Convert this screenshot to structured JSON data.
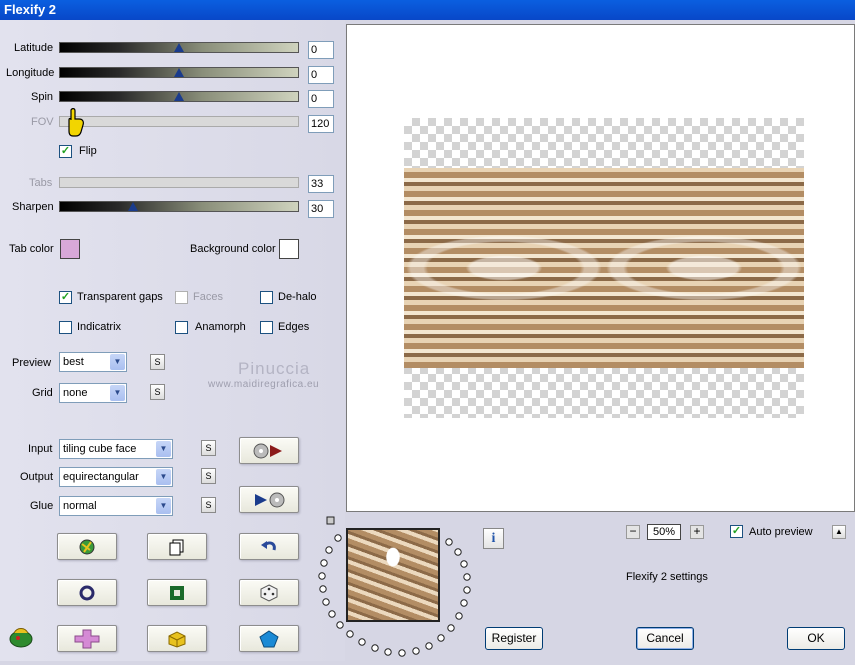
{
  "window": {
    "title": "Flexify 2"
  },
  "sliders": {
    "latitude": {
      "label": "Latitude",
      "value": "0"
    },
    "longitude": {
      "label": "Longitude",
      "value": "0"
    },
    "spin": {
      "label": "Spin",
      "value": "0"
    },
    "fov": {
      "label": "FOV",
      "value": "120"
    },
    "tabs": {
      "label": "Tabs",
      "value": "33"
    },
    "sharpen": {
      "label": "Sharpen",
      "value": "30"
    }
  },
  "flip": {
    "label": "Flip",
    "checked": true
  },
  "colors": {
    "tab_color_label": "Tab color",
    "tab_color": "#d8a8d8",
    "background_color_label": "Background color",
    "background_color": "#ffffff"
  },
  "options": {
    "transparent_gaps": "Transparent gaps",
    "faces": "Faces",
    "de_halo": "De-halo",
    "indicatrix": "Indicatrix",
    "anamorph": "Anamorph",
    "edges": "Edges"
  },
  "preview_select": {
    "label": "Preview",
    "value": "best"
  },
  "grid_select": {
    "label": "Grid",
    "value": "none"
  },
  "input_select": {
    "label": "Input",
    "value": "tiling cube face"
  },
  "output_select": {
    "label": "Output",
    "value": "equirectangular"
  },
  "glue_select": {
    "label": "Glue",
    "value": "normal"
  },
  "s_button_label": "S",
  "watermark": {
    "name": "Pinuccia",
    "url": "www.maidiregrafica.eu"
  },
  "zoom": {
    "value": "50%"
  },
  "auto_preview": {
    "label": "Auto preview",
    "checked": true
  },
  "settings_text": "Flexify 2 settings",
  "info_label": "i",
  "buttons": {
    "register": "Register",
    "cancel": "Cancel",
    "ok": "OK"
  }
}
